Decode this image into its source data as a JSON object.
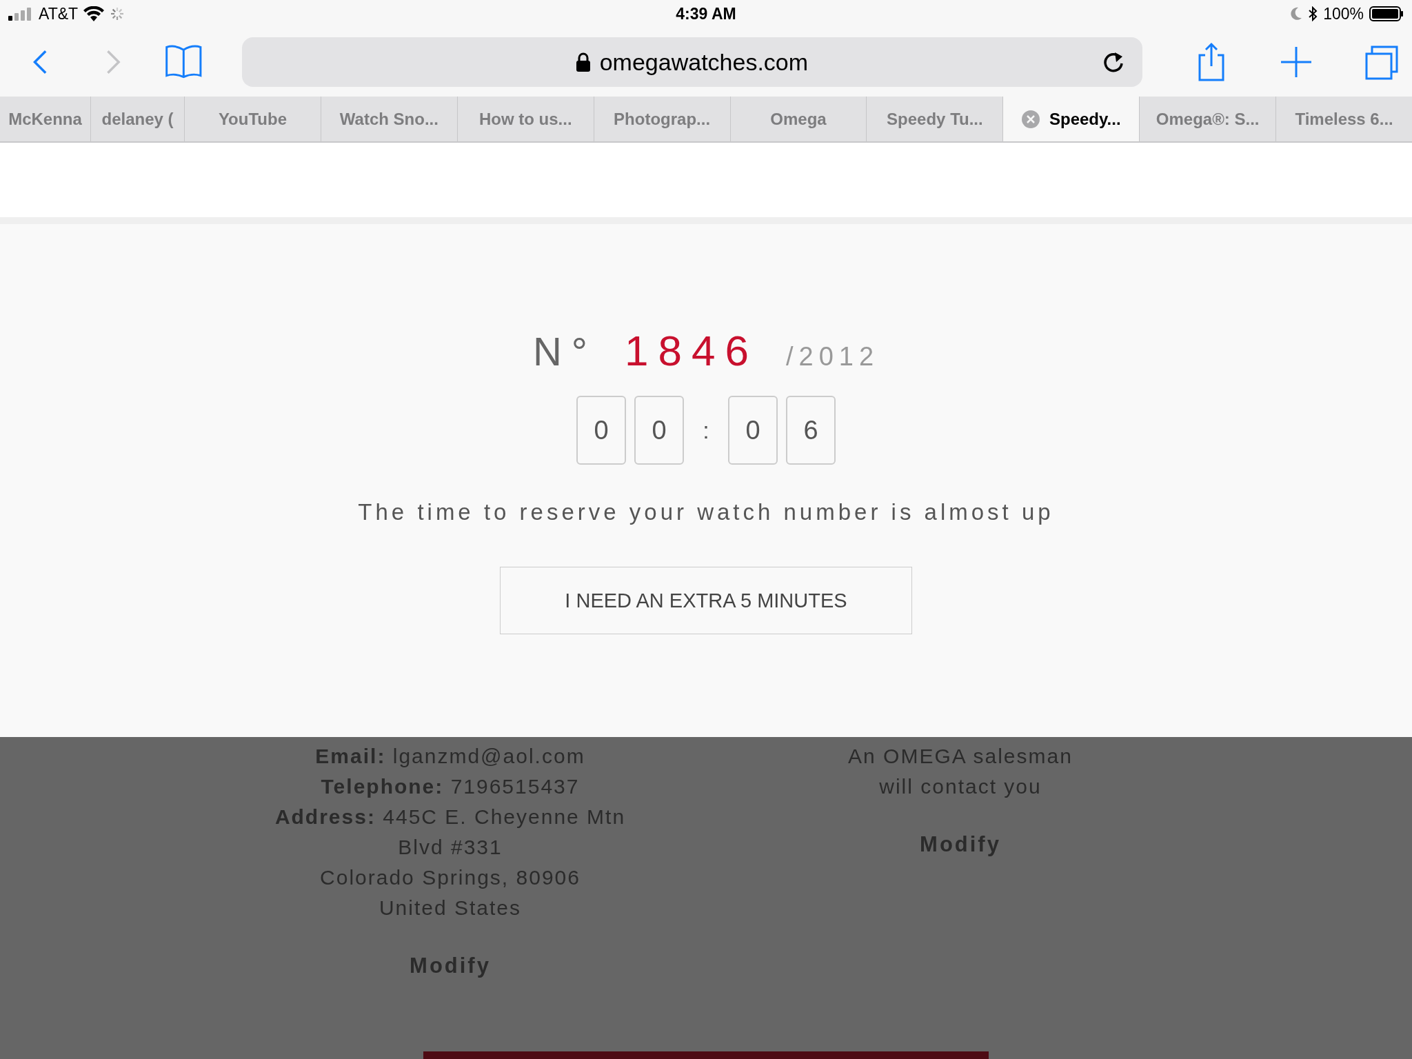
{
  "status_bar": {
    "carrier": "AT&T",
    "time": "4:39 AM",
    "battery": "100%"
  },
  "toolbar": {
    "back": {
      "disabled": false
    },
    "forward": {
      "disabled": true
    },
    "address": "omegawatches.com"
  },
  "tabs": [
    {
      "label": "McKenna",
      "selected": false
    },
    {
      "label": "delaney (",
      "selected": false
    },
    {
      "label": "YouTube",
      "selected": false
    },
    {
      "label": "Watch Sno...",
      "selected": false
    },
    {
      "label": "How to us...",
      "selected": false
    },
    {
      "label": "Photograp...",
      "selected": false
    },
    {
      "label": "Omega",
      "selected": false
    },
    {
      "label": "Speedy Tu...",
      "selected": false
    },
    {
      "label": "Speedy...",
      "selected": true
    },
    {
      "label": "Omega®: S...",
      "selected": false
    },
    {
      "label": "Timeless 6...",
      "selected": false
    }
  ],
  "reservation": {
    "prefix": "N°",
    "number": "1846",
    "total": "/2012",
    "countdown": [
      {
        "kind": "digit",
        "text": "0"
      },
      {
        "kind": "digit",
        "text": "0"
      },
      {
        "kind": "separator",
        "text": ":"
      },
      {
        "kind": "digit",
        "text": "0"
      },
      {
        "kind": "digit",
        "text": "6"
      }
    ],
    "message": "The time to reserve your watch number is almost up",
    "button": "I NEED AN EXTRA 5 MINUTES"
  },
  "background_page": {
    "contact": {
      "lines": [
        "**Email:** lganzmd@aol.com",
        "**Telephone:** 7196515437",
        "**Address:** 445C E. Cheyenne Mtn",
        "Blvd #331",
        "Colorado Springs, 80906",
        "United States"
      ],
      "link": "Modify"
    },
    "delivery": {
      "lines": [
        "An OMEGA salesman",
        "will contact you"
      ],
      "link": "Modify"
    }
  }
}
